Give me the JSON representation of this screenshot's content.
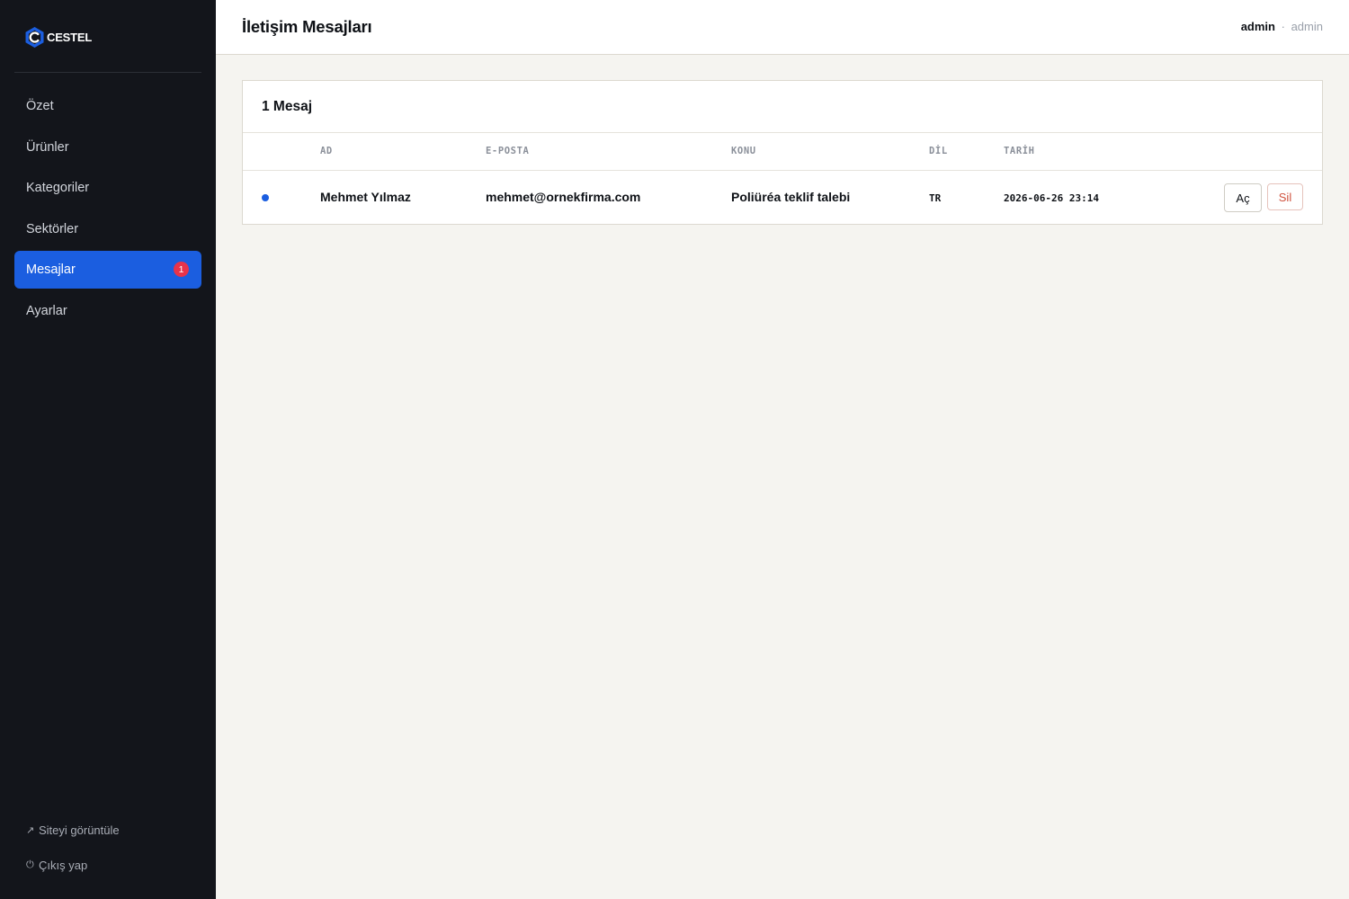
{
  "brand": {
    "name": "CESTEL",
    "accent": "#1b5ee0"
  },
  "sidebar": {
    "items": [
      {
        "label": "Özet"
      },
      {
        "label": "Ürünler"
      },
      {
        "label": "Kategoriler"
      },
      {
        "label": "Sektörler"
      },
      {
        "label": "Mesajlar",
        "badge": "1",
        "active": true
      },
      {
        "label": "Ayarlar"
      }
    ],
    "footer": {
      "view_site": {
        "icon": "external-link-icon",
        "glyph": "↗",
        "label": "Siteyi görüntüle"
      },
      "logout": {
        "icon": "power-icon",
        "glyph": "⏻",
        "label": "Çıkış yap"
      }
    }
  },
  "header": {
    "title": "İletişim Mesajları",
    "user_name": "admin",
    "separator": "·",
    "user_role": "admin"
  },
  "messages": {
    "count_label": "1 Mesaj",
    "columns": [
      "AD",
      "E-POSTA",
      "KONU",
      "DİL",
      "TARİH"
    ],
    "rows": [
      {
        "unread": true,
        "name": "Mehmet Yılmaz",
        "email": "mehmet@ornekfirma.com",
        "subject": "Poliüréa teklif talebi",
        "lang": "TR",
        "date": "2026-06-26 23:14",
        "open_label": "Aç",
        "delete_label": "Sil"
      }
    ]
  }
}
